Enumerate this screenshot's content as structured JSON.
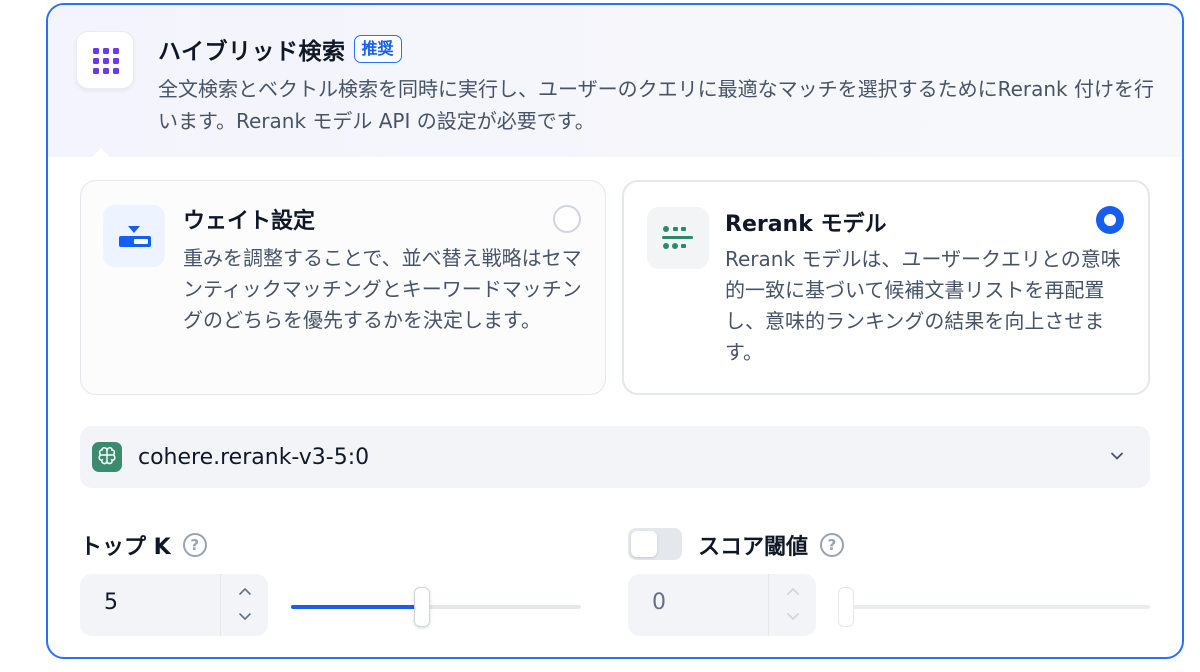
{
  "header": {
    "title": "ハイブリッド検索",
    "badge": "推奨",
    "description": "全文検索とベクトル検索を同時に実行し、ユーザーのクエリに最適なマッチを選択するためにRerank 付けを行います。Rerank モデル API の設定が必要です。",
    "icon": "grid-icon"
  },
  "options": [
    {
      "title": "ウェイト設定",
      "description": "重みを調整することで、並べ替え戦略はセマンティックマッチングとキーワードマッチングのどちらを優先するかを決定します。",
      "selected": false,
      "icon": "weight-icon"
    },
    {
      "title": "Rerank モデル",
      "description": "Rerank モデルは、ユーザークエリとの意味的一致に基づいて候補文書リストを再配置し、意味的ランキングの結果を向上させます。",
      "selected": true,
      "icon": "rerank-icon"
    }
  ],
  "model_select": {
    "value": "cohere.rerank-v3-5:0",
    "icon": "model-provider-icon"
  },
  "top_k": {
    "label": "トップ K",
    "value": "5",
    "slider_fraction": 0.45
  },
  "score_threshold": {
    "label": "スコア閾値",
    "enabled": false,
    "value": "0",
    "slider_fraction": 0
  },
  "colors": {
    "accent": "#155eef",
    "selected_border": "#2970ff",
    "grid_icon": "#6938ef",
    "model_icon_bg": "#3b8c6e",
    "rerank_icon": "#2a8a6b"
  }
}
